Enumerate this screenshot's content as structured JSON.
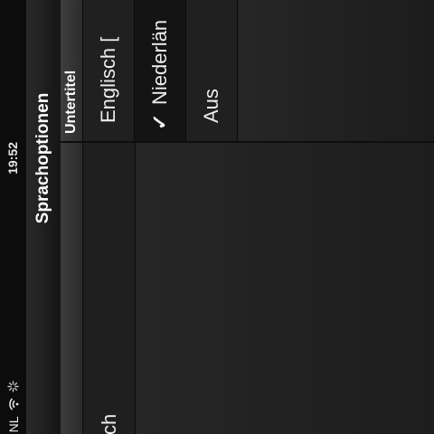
{
  "status_bar": {
    "carrier": "e NL",
    "time": "19:52",
    "wifi_icon": "wifi-icon",
    "activity_icon": "spinner-icon"
  },
  "nav": {
    "title": "Sprachoptionen"
  },
  "audio": {
    "items": [
      {
        "label": "sch"
      }
    ]
  },
  "subtitles": {
    "header": "Untertitel",
    "items": [
      {
        "label": "Englisch [",
        "selected": false
      },
      {
        "label": "Niederlän",
        "selected": true
      },
      {
        "label": "Aus",
        "selected": false
      }
    ],
    "check_mark": "✓"
  }
}
